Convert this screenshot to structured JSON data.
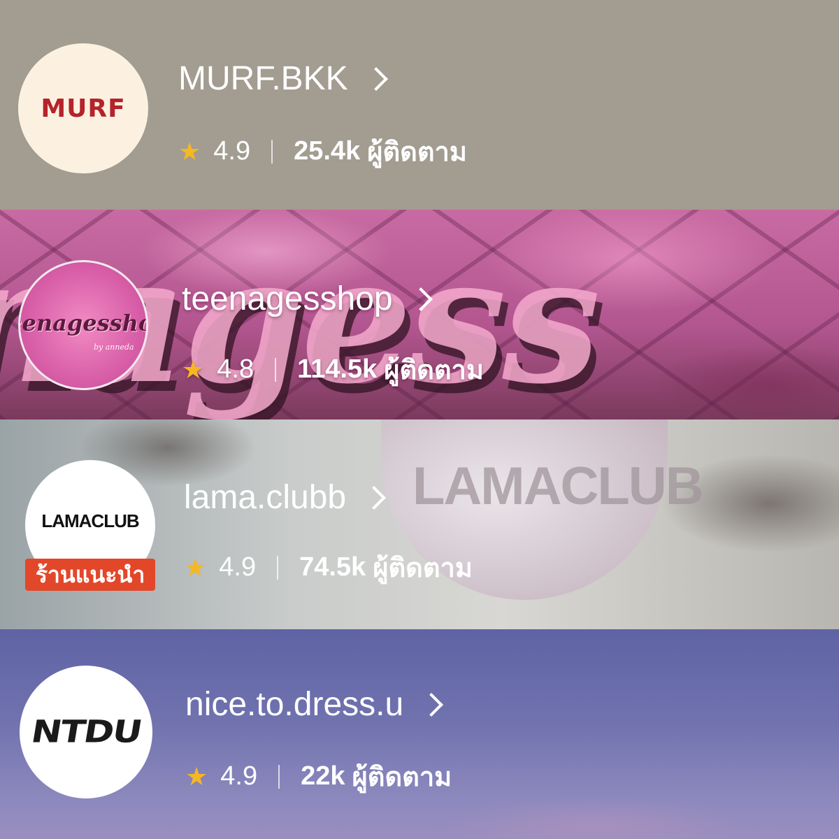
{
  "shops": [
    {
      "name": "MURF.BKK",
      "logo_text": "MURF",
      "rating": "4.9",
      "followers": "25.4k",
      "followers_label": "ผู้ติดตาม"
    },
    {
      "name": "teenagesshop",
      "logo_text": "teenagesshop",
      "logo_subtext": "by anneda",
      "banner_word": "nagess",
      "rating": "4.8",
      "followers": "114.5k",
      "followers_label": "ผู้ติดตาม"
    },
    {
      "name": "lama.clubb",
      "logo_text": "LAMACLUB",
      "banner_word": "LAMACLUB",
      "badge": "ร้านแนะนำ",
      "rating": "4.9",
      "followers": "74.5k",
      "followers_label": "ผู้ติดตาม"
    },
    {
      "name": "nice.to.dress.u",
      "logo_text": "NTDU",
      "rating": "4.9",
      "followers": "22k",
      "followers_label": "ผู้ติดตาม"
    }
  ],
  "colors": {
    "star": "#f5b724",
    "badge": "#e2472a",
    "murf_logo": "#b5232a"
  },
  "icons": {
    "rating": "star-icon",
    "navigate": "chevron-right-icon"
  }
}
